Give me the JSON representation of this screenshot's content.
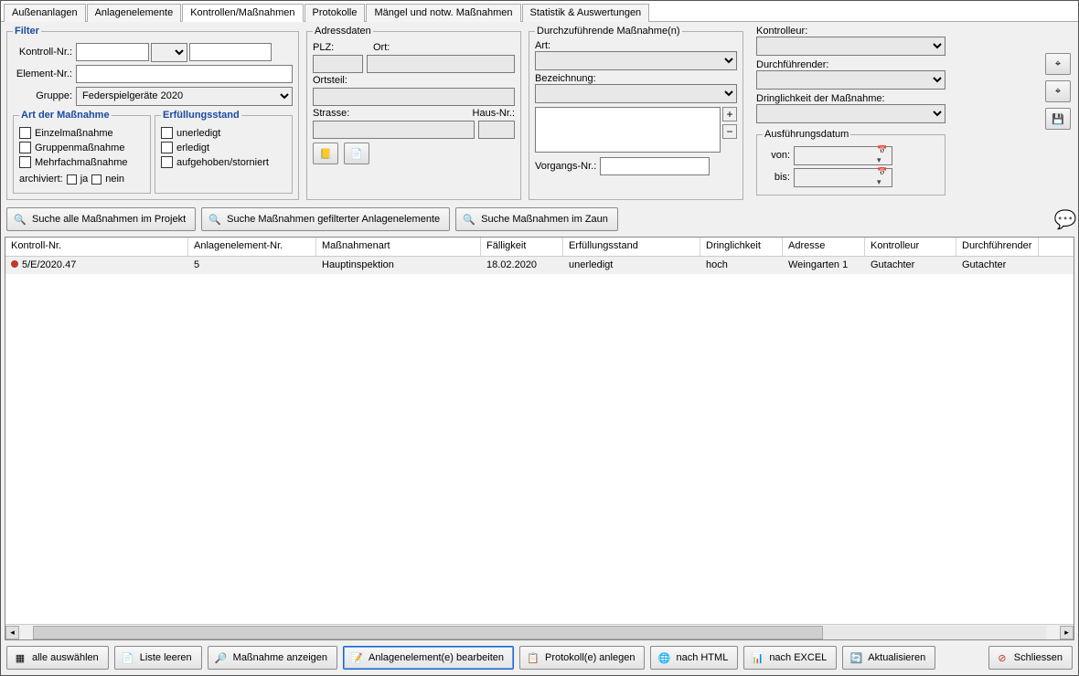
{
  "tabs": [
    "Außenanlagen",
    "Anlagenelemente",
    "Kontrollen/Maßnahmen",
    "Protokolle",
    "Mängel und notw. Maßnahmen",
    "Statistik & Auswertungen"
  ],
  "active_tab_index": 2,
  "filter": {
    "title": "Filter",
    "kontroll_nr_label": "Kontroll-Nr.:",
    "element_nr_label": "Element-Nr.:",
    "gruppe_label": "Gruppe:",
    "gruppe_value": "Federspielgeräte 2020",
    "art_group": "Art der Maßnahme",
    "art_items": [
      "Einzelmaßnahme",
      "Gruppenmaßnahme",
      "Mehrfachmaßnahme"
    ],
    "archiviert_label": "archiviert:",
    "archiviert_yes": "ja",
    "archiviert_no": "nein",
    "erf_group": "Erfüllungsstand",
    "erf_items": [
      "unerledigt",
      "erledigt",
      "aufgehoben/storniert"
    ]
  },
  "address": {
    "title": "Adressdaten",
    "plz": "PLZ:",
    "ort": "Ort:",
    "ortsteil": "Ortsteil:",
    "strasse": "Strasse:",
    "hausnr": "Haus-Nr.:"
  },
  "durch": {
    "title": "Durchzuführende Maßnahme(n)",
    "art": "Art:",
    "bez": "Bezeichnung:",
    "vorgang": "Vorgangs-Nr.:"
  },
  "right": {
    "kontrolleur": "Kontrolleur:",
    "durchfuehrender": "Durchführender:",
    "dringlichkeit": "Dringlichkeit der Maßnahme:",
    "ausfuehrung_title": "Ausführungsdatum",
    "von": "von:",
    "bis": "bis:"
  },
  "search_buttons": {
    "projekt": "Suche alle Maßnahmen im Projekt",
    "gefiltert": "Suche Maßnahmen gefilterter Anlagenelemente",
    "zaun": "Suche Maßnahmen im Zaun"
  },
  "table": {
    "headers": [
      "Kontroll-Nr.",
      "Anlagenelement-Nr.",
      "Maßnahmenart",
      "Fälligkeit",
      "Erfüllungsstand",
      "Dringlichkeit",
      "Adresse",
      "Kontrolleur",
      "Durchführender"
    ],
    "rows": [
      {
        "kontroll": "5/E/2020.47",
        "element": "5",
        "art": "Hauptinspektion",
        "faellig": "18.02.2020",
        "erf": "unerledigt",
        "dring": "hoch",
        "adresse": "Weingarten 1",
        "kontr": "Gutachter",
        "durch": "Gutachter"
      }
    ]
  },
  "bottom_buttons": {
    "alle": "alle auswählen",
    "leeren": "Liste leeren",
    "anzeigen": "Maßnahme anzeigen",
    "bearbeiten": "Anlagenelement(e) bearbeiten",
    "protokoll": "Protokoll(e) anlegen",
    "html": "nach HTML",
    "excel": "nach EXCEL",
    "aktual": "Aktualisieren",
    "schliessen": "Schliessen"
  }
}
